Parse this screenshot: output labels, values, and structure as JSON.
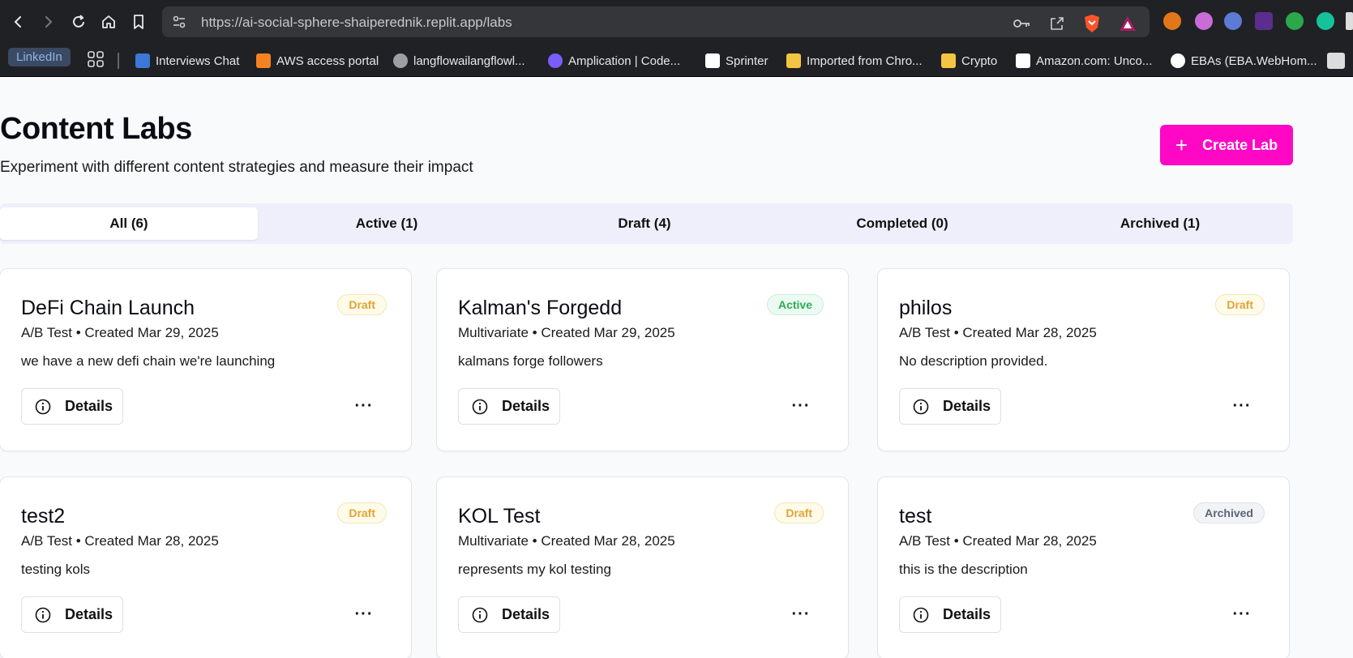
{
  "browser": {
    "url": "https://ai-social-sphere-shaiperednik.replit.app/labs",
    "bookmarks": [
      {
        "label": "LinkedIn"
      },
      {
        "label": "Interviews Chat",
        "color": "#3c78d8"
      },
      {
        "label": "AWS access portal",
        "color": "#f58220"
      },
      {
        "label": "langflowailangflowl...",
        "color": "#9aa0a6"
      },
      {
        "label": "Amplication | Code...",
        "color": "#7b5cff"
      },
      {
        "label": "Sprinter",
        "color": "#ffffff"
      },
      {
        "label": "Imported from Chro...",
        "color": "#f4c542"
      },
      {
        "label": "Crypto",
        "color": "#f4c542"
      },
      {
        "label": "Amazon.com: Unco...",
        "color": "#ffffff"
      },
      {
        "label": "EBAs (EBA.WebHom...",
        "color": "#ffffff"
      }
    ]
  },
  "header": {
    "title": "Content Labs",
    "subtitle": "Experiment with different content strategies and measure their impact",
    "create_label": "Create Lab",
    "accent": "#ff08c5"
  },
  "tabs": [
    {
      "label": "All (6)",
      "active": true
    },
    {
      "label": "Active (1)"
    },
    {
      "label": "Draft (4)"
    },
    {
      "label": "Completed (0)"
    },
    {
      "label": "Archived (1)"
    }
  ],
  "labs": [
    {
      "title": "DeFi Chain Launch",
      "meta": "A/B Test • Created Mar 29, 2025",
      "description": "we have a new defi chain we're launching",
      "status": "Draft",
      "details_label": "Details"
    },
    {
      "title": "Kalman's Forgedd",
      "meta": "Multivariate • Created Mar 29, 2025",
      "description": "kalmans forge followers",
      "status": "Active",
      "details_label": "Details"
    },
    {
      "title": "philos",
      "meta": "A/B Test • Created Mar 28, 2025",
      "description": "No description provided.",
      "status": "Draft",
      "details_label": "Details"
    },
    {
      "title": "test2",
      "meta": "A/B Test • Created Mar 28, 2025",
      "description": "testing kols",
      "status": "Draft",
      "details_label": "Details"
    },
    {
      "title": "KOL Test",
      "meta": "Multivariate • Created Mar 28, 2025",
      "description": "represents my kol testing",
      "status": "Draft",
      "details_label": "Details"
    },
    {
      "title": "test",
      "meta": "A/B Test • Created Mar 28, 2025",
      "description": "this is the description",
      "status": "Archived",
      "details_label": "Details"
    }
  ],
  "more_label": "···"
}
